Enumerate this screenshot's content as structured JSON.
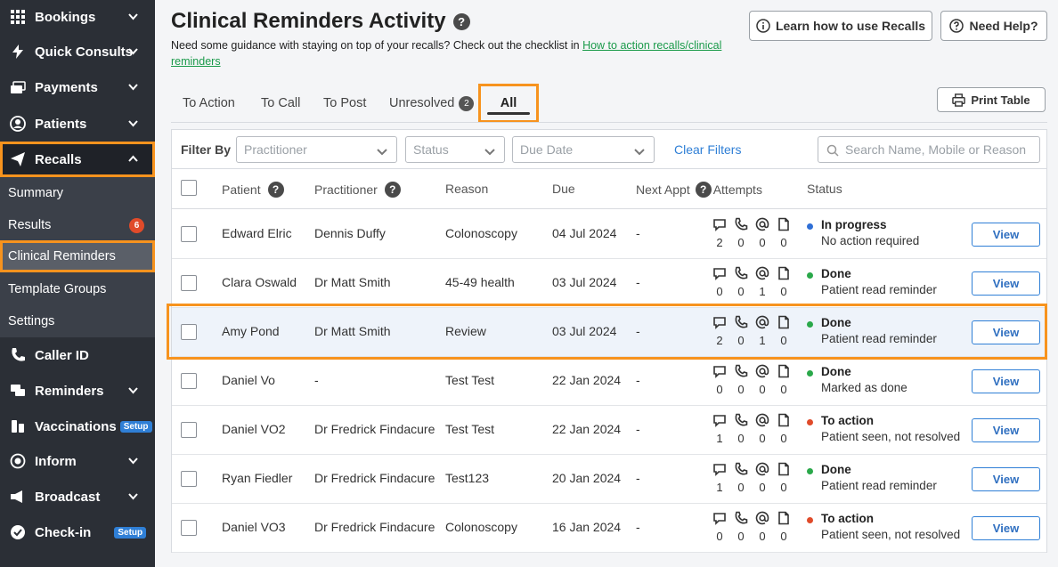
{
  "sidebar": {
    "items": [
      {
        "label": "Bookings",
        "icon": "grid-icon",
        "chevron": "down"
      },
      {
        "label": "Quick Consults",
        "icon": "lightning-icon",
        "chevron": "down"
      },
      {
        "label": "Payments",
        "icon": "payment-icon",
        "chevron": "down"
      },
      {
        "label": "Patients",
        "icon": "patient-icon",
        "chevron": "down"
      },
      {
        "label": "Recalls",
        "icon": "paper-plane-icon",
        "chevron": "up"
      },
      {
        "label": "Caller ID",
        "icon": "phone-icon"
      },
      {
        "label": "Reminders",
        "icon": "chat-icon",
        "chevron": "down"
      },
      {
        "label": "Vaccinations",
        "icon": "vaccine-icon",
        "tag": "Setup"
      },
      {
        "label": "Inform",
        "icon": "target-icon",
        "chevron": "down"
      },
      {
        "label": "Broadcast",
        "icon": "megaphone-icon",
        "chevron": "down"
      },
      {
        "label": "Check-in",
        "icon": "check-circle-icon",
        "tag": "Setup"
      }
    ],
    "recalls_sub": [
      {
        "label": "Summary"
      },
      {
        "label": "Results",
        "badge": "6"
      },
      {
        "label": "Clinical Reminders"
      },
      {
        "label": "Template Groups"
      },
      {
        "label": "Settings"
      }
    ]
  },
  "header": {
    "title": "Clinical Reminders Activity",
    "help": "?",
    "guidance_text": "Need some guidance with staying on top of your recalls? Check out the checklist in ",
    "guidance_link": "How to action recalls/clinical reminders",
    "learn_button": "Learn how to use Recalls",
    "help_button": "Need Help?"
  },
  "tabs": [
    {
      "label": "To Action"
    },
    {
      "label": "To Call"
    },
    {
      "label": "To Post"
    },
    {
      "label": "Unresolved",
      "count": "2"
    },
    {
      "label": "All",
      "active": true
    }
  ],
  "print_button": "Print Table",
  "filters": {
    "label": "Filter By",
    "practitioner_placeholder": "Practitioner",
    "status_placeholder": "Status",
    "due_date_placeholder": "Due Date",
    "clear": "Clear Filters",
    "search_placeholder": "Search Name, Mobile or Reason"
  },
  "table": {
    "columns": {
      "patient": "Patient",
      "practitioner": "Practitioner",
      "reason": "Reason",
      "due": "Due",
      "next_appt": "Next Appt",
      "attempts": "Attempts",
      "status": "Status"
    },
    "view_label": "View",
    "rows": [
      {
        "patient": "Edward Elric",
        "practitioner": "Dennis Duffy",
        "reason": "Colonoscopy",
        "due": "04 Jul 2024",
        "next_appt": "-",
        "attempts": [
          "2",
          "0",
          "0",
          "0"
        ],
        "status": "In progress",
        "status_sub": "No action required",
        "status_color": "#2f6fd6"
      },
      {
        "patient": "Clara Oswald",
        "practitioner": "Dr Matt Smith",
        "reason": "45-49 health",
        "due": "03 Jul 2024",
        "next_appt": "-",
        "attempts": [
          "0",
          "0",
          "1",
          "0"
        ],
        "status": "Done",
        "status_sub": "Patient read reminder",
        "status_color": "#2aa84a"
      },
      {
        "patient": "Amy Pond",
        "practitioner": "Dr Matt Smith",
        "reason": "Review",
        "due": "03 Jul 2024",
        "next_appt": "-",
        "attempts": [
          "2",
          "0",
          "1",
          "0"
        ],
        "status": "Done",
        "status_sub": "Patient read reminder",
        "status_color": "#2aa84a"
      },
      {
        "patient": "Daniel Vo",
        "practitioner": "-",
        "reason": "Test Test",
        "due": "22 Jan 2024",
        "next_appt": "-",
        "attempts": [
          "0",
          "0",
          "0",
          "0"
        ],
        "status": "Done",
        "status_sub": "Marked as done",
        "status_color": "#2aa84a"
      },
      {
        "patient": "Daniel VO2",
        "practitioner": "Dr Fredrick Findacure",
        "reason": "Test Test",
        "due": "22 Jan 2024",
        "next_appt": "-",
        "attempts": [
          "1",
          "0",
          "0",
          "0"
        ],
        "status": "To action",
        "status_sub": "Patient seen, not resolved",
        "status_color": "#e04b2a"
      },
      {
        "patient": "Ryan Fiedler",
        "practitioner": "Dr Fredrick Findacure",
        "reason": "Test123",
        "due": "20 Jan 2024",
        "next_appt": "-",
        "attempts": [
          "1",
          "0",
          "0",
          "0"
        ],
        "status": "Done",
        "status_sub": "Patient read reminder",
        "status_color": "#2aa84a"
      },
      {
        "patient": "Daniel VO3",
        "practitioner": "Dr Fredrick Findacure",
        "reason": "Colonoscopy",
        "due": "16 Jan 2024",
        "next_appt": "-",
        "attempts": [
          "0",
          "0",
          "0",
          "0"
        ],
        "status": "To action",
        "status_sub": "Patient seen, not resolved",
        "status_color": "#e04b2a"
      }
    ]
  }
}
